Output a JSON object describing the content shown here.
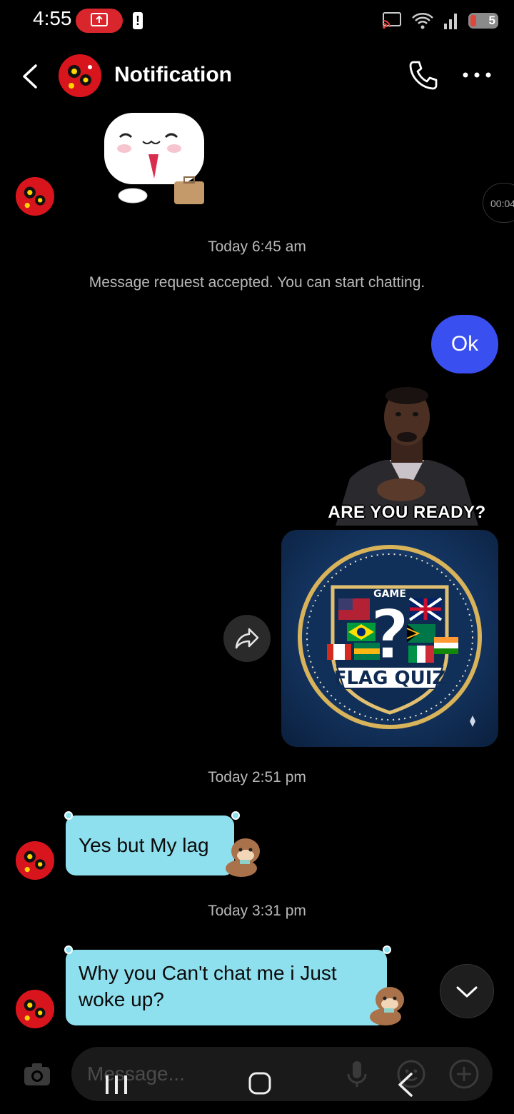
{
  "status_bar": {
    "time": "4:55",
    "battery": "5"
  },
  "header": {
    "title": "Notification"
  },
  "chat": {
    "timer": "00:04",
    "timestamp_1": "Today 6:45 am",
    "system_note": "Message request accepted. You can start chatting.",
    "sent_text": "Ok",
    "gif_caption": "ARE YOU READY?",
    "quiz_game_label": "GAME",
    "quiz_title": "FLAG QUIZ",
    "timestamp_2": "Today 2:51 pm",
    "received_1": "Yes but My lag",
    "timestamp_3": "Today 3:31 pm",
    "received_2": "Why you Can't chat me i Just woke up?"
  },
  "composer": {
    "placeholder": "Message..."
  },
  "colors": {
    "sent_bubble": "#3a4ff0",
    "received_bubble": "#8fe0ee",
    "background": "#000000"
  }
}
